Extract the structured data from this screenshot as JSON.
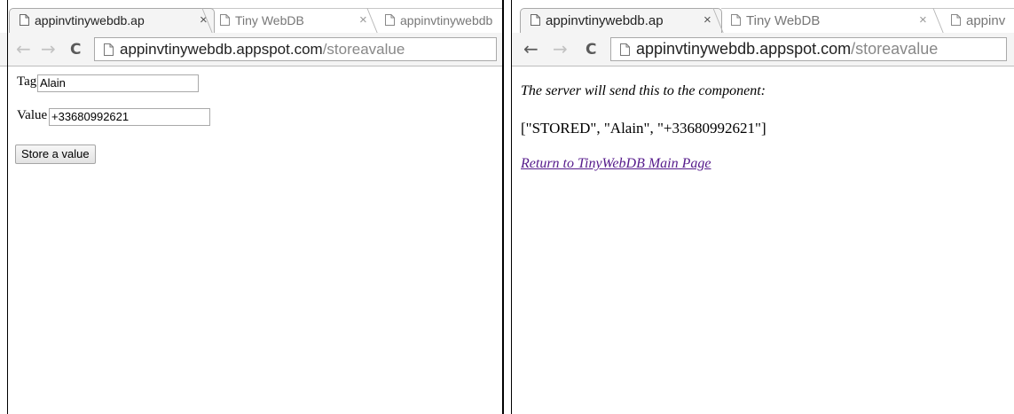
{
  "left": {
    "tabs": [
      {
        "title": "appinvtinywebdb.ap",
        "close": "×"
      },
      {
        "title": "Tiny WebDB",
        "close": "×"
      },
      {
        "title": "appinvtinywebdb"
      }
    ],
    "url": {
      "host": "appinvtinywebdb.appspot.com",
      "path": "/storeavalue"
    },
    "form": {
      "tag_label": "Tag",
      "tag_value": "Alain",
      "value_label": "Value",
      "value_value": "+33680992621",
      "submit_label": "Store a value"
    }
  },
  "right": {
    "tabs": [
      {
        "title": "appinvtinywebdb.ap",
        "close": "×"
      },
      {
        "title": "Tiny WebDB",
        "close": "×"
      },
      {
        "title": "appinv"
      }
    ],
    "url": {
      "host": "appinvtinywebdb.appspot.com",
      "path": "/storeavalue"
    },
    "result": {
      "intro": "The server will send this to the component:",
      "response": "[\"STORED\", \"Alain\", \"+33680992621\"]",
      "return_link": "Return to TinyWebDB Main Page"
    }
  },
  "icons": {
    "back": "back-arrow-icon",
    "forward": "forward-arrow-icon",
    "reload": "reload-icon",
    "page": "page-icon"
  }
}
